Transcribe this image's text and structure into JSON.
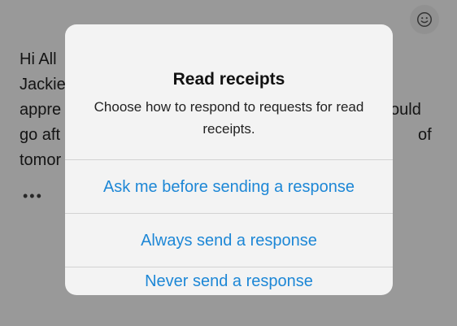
{
  "email": {
    "lines": [
      "Hi All",
      "Jackie",
      "appre",
      "go aft",
      "tomor"
    ],
    "right_fragments": [
      "ould",
      "of"
    ],
    "more": "•••"
  },
  "emoji_button": {
    "icon": "smiley-icon"
  },
  "dialog": {
    "title": "Read receipts",
    "message": "Choose how to respond to requests for read receipts.",
    "options": [
      "Ask me before sending a response",
      "Always send a response",
      "Never send a response"
    ]
  },
  "colors": {
    "accent": "#1d87d6",
    "dialog_bg": "#f3f3f3",
    "dim_overlay": "rgba(0,0,0,0.40)"
  }
}
